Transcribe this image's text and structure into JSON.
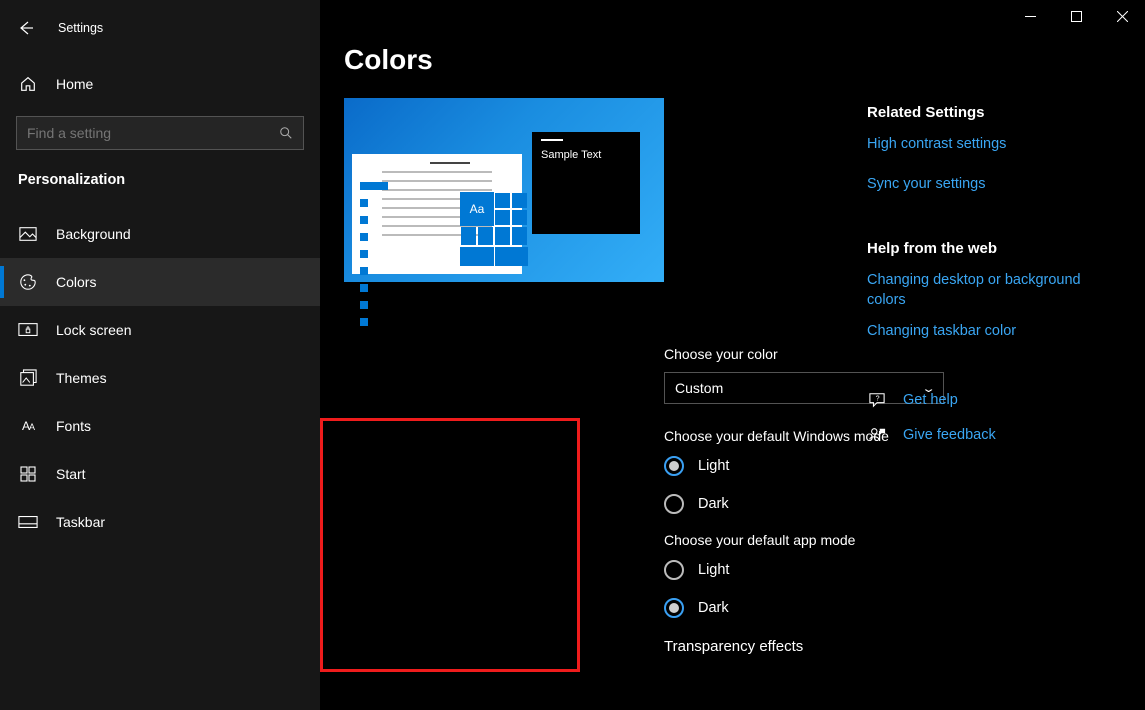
{
  "window_title": "Settings",
  "home_label": "Home",
  "search_placeholder": "Find a setting",
  "section_label": "Personalization",
  "nav": [
    {
      "id": "background",
      "label": "Background",
      "selected": false
    },
    {
      "id": "colors",
      "label": "Colors",
      "selected": true
    },
    {
      "id": "lock-screen",
      "label": "Lock screen",
      "selected": false
    },
    {
      "id": "themes",
      "label": "Themes",
      "selected": false
    },
    {
      "id": "fonts",
      "label": "Fonts",
      "selected": false
    },
    {
      "id": "start",
      "label": "Start",
      "selected": false
    },
    {
      "id": "taskbar",
      "label": "Taskbar",
      "selected": false
    }
  ],
  "page_title": "Colors",
  "preview_sample_text": "Sample Text",
  "preview_tile_label": "Aa",
  "choose_color_label": "Choose your color",
  "choose_color_value": "Custom",
  "windows_mode": {
    "label": "Choose your default Windows mode",
    "option_light": "Light",
    "option_dark": "Dark",
    "selected": "Light"
  },
  "app_mode": {
    "label": "Choose your default app mode",
    "option_light": "Light",
    "option_dark": "Dark",
    "selected": "Dark"
  },
  "transparency_label": "Transparency effects",
  "related": {
    "heading": "Related Settings",
    "high_contrast": "High contrast settings",
    "sync": "Sync your settings"
  },
  "help": {
    "heading": "Help from the web",
    "link1": "Changing desktop or background colors",
    "link2": "Changing taskbar color"
  },
  "actions": {
    "get_help": "Get help",
    "feedback": "Give feedback"
  },
  "accent": "#0078d4",
  "link_color": "#3aa6f3"
}
